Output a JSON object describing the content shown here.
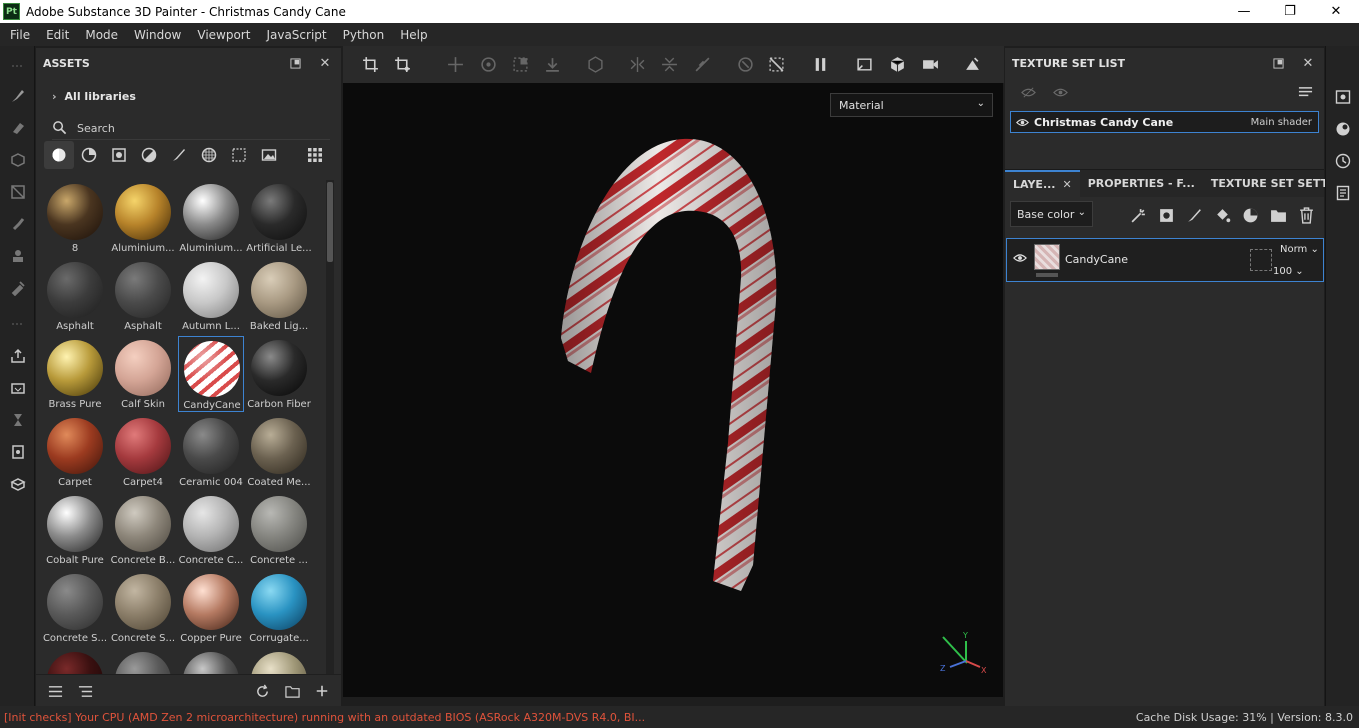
{
  "window": {
    "logo_text": "Pt",
    "title": "Adobe Substance 3D Painter - Christmas Candy Cane",
    "minimize": "—",
    "maximize": "❐",
    "close": "✕"
  },
  "menu": [
    "File",
    "Edit",
    "Mode",
    "Window",
    "Viewport",
    "JavaScript",
    "Python",
    "Help"
  ],
  "assets": {
    "title": "ASSETS",
    "all_libraries": "All libraries",
    "search_placeholder": "Search",
    "items": [
      {
        "label": "8",
        "colors": [
          "#c9a76a",
          "#4a3520",
          "#1a0f08"
        ]
      },
      {
        "label": "Aluminium...",
        "colors": [
          "#f5d46a",
          "#b7832a",
          "#3d2606"
        ]
      },
      {
        "label": "Aluminium...",
        "colors": [
          "#ffffff",
          "#8a8a8a",
          "#1a1a1a"
        ]
      },
      {
        "label": "Artificial Le...",
        "colors": [
          "#7a7a7a",
          "#2a2a2a",
          "#0d0d0d"
        ]
      },
      {
        "label": "Asphalt",
        "colors": [
          "#6a6a6a",
          "#3c3c3c",
          "#1c1c1c"
        ]
      },
      {
        "label": "Asphalt",
        "colors": [
          "#7a7a7a",
          "#4a4a4a",
          "#222222"
        ]
      },
      {
        "label": "Autumn L...",
        "colors": [
          "#f3f3f3",
          "#c8c8c8",
          "#7a7a7a"
        ]
      },
      {
        "label": "Baked Lig...",
        "colors": [
          "#d9cdb8",
          "#a99a83",
          "#5c5140"
        ]
      },
      {
        "label": "Brass Pure",
        "colors": [
          "#fff3b0",
          "#b89a3a",
          "#3e3005"
        ]
      },
      {
        "label": "Calf Skin",
        "colors": [
          "#f4cfc0",
          "#d4a596",
          "#8e6557"
        ]
      },
      {
        "label": "CandyCane",
        "colors": [
          "#ffffff",
          "#d94b4b",
          "#7d1f1f"
        ]
      },
      {
        "label": "Carbon Fiber",
        "colors": [
          "#8a8a8a",
          "#2a2a2a",
          "#050505"
        ]
      },
      {
        "label": "Carpet",
        "colors": [
          "#e08a5a",
          "#9c3b20",
          "#3d130a"
        ]
      },
      {
        "label": "Carpet4",
        "colors": [
          "#e07a7a",
          "#a53a3e",
          "#4a1214"
        ]
      },
      {
        "label": "Ceramic 004",
        "colors": [
          "#8a8a8a",
          "#4a4a4a",
          "#1e1e1e"
        ]
      },
      {
        "label": "Coated Me...",
        "colors": [
          "#b8ad96",
          "#6b6150",
          "#2a241a"
        ]
      },
      {
        "label": "Cobalt Pure",
        "colors": [
          "#ffffff",
          "#8c8c8c",
          "#1e1e1e"
        ]
      },
      {
        "label": "Concrete B...",
        "colors": [
          "#cfcac0",
          "#8e877b",
          "#4a453c"
        ]
      },
      {
        "label": "Concrete C...",
        "colors": [
          "#e6e6e6",
          "#b4b4b4",
          "#6a6a6a"
        ]
      },
      {
        "label": "Concrete ...",
        "colors": [
          "#b8b8b4",
          "#858580",
          "#4a4a46"
        ]
      },
      {
        "label": "Concrete S...",
        "colors": [
          "#8a8a8a",
          "#5a5a5a",
          "#2a2a2a"
        ]
      },
      {
        "label": "Concrete S...",
        "colors": [
          "#c2b6a2",
          "#8c7f6a",
          "#4a4030"
        ]
      },
      {
        "label": "Copper Pure",
        "colors": [
          "#ffe0d2",
          "#b57a62",
          "#3d1e12"
        ]
      },
      {
        "label": "Corrugate...",
        "colors": [
          "#8ad9f2",
          "#2a93c2",
          "#0a3a5a"
        ]
      },
      {
        "label": "",
        "colors": [
          "#7a2a2a",
          "#3a1010",
          "#150505"
        ]
      },
      {
        "label": "",
        "colors": [
          "#9a9a9a",
          "#5a5a5a",
          "#2a2a2a"
        ]
      },
      {
        "label": "",
        "colors": [
          "#c8c8c8",
          "#555555",
          "#151515"
        ]
      },
      {
        "label": "",
        "colors": [
          "#e8e0c8",
          "#a09878",
          "#4a4430"
        ]
      }
    ]
  },
  "viewport": {
    "material_mode": "Material",
    "axis_y": "Y",
    "axis_x": "X",
    "axis_z": "Z"
  },
  "texture_set": {
    "title": "TEXTURE SET LIST",
    "item_name": "Christmas Candy Cane",
    "item_shader": "Main shader"
  },
  "tabs": [
    "LAYE...",
    "PROPERTIES - F...",
    "TEXTURE SET SETTIN..."
  ],
  "layers": {
    "channel": "Base color",
    "layer_name": "CandyCane",
    "blend_mode": "Norm",
    "opacity": "100"
  },
  "status": {
    "message": "[Init checks] Your CPU (AMD Zen 2 microarchitecture) running with an outdated BIOS (ASRock A320M-DVS R4.0, BI...",
    "cache": "Cache Disk Usage:   31% | Version: 8.3.0"
  }
}
